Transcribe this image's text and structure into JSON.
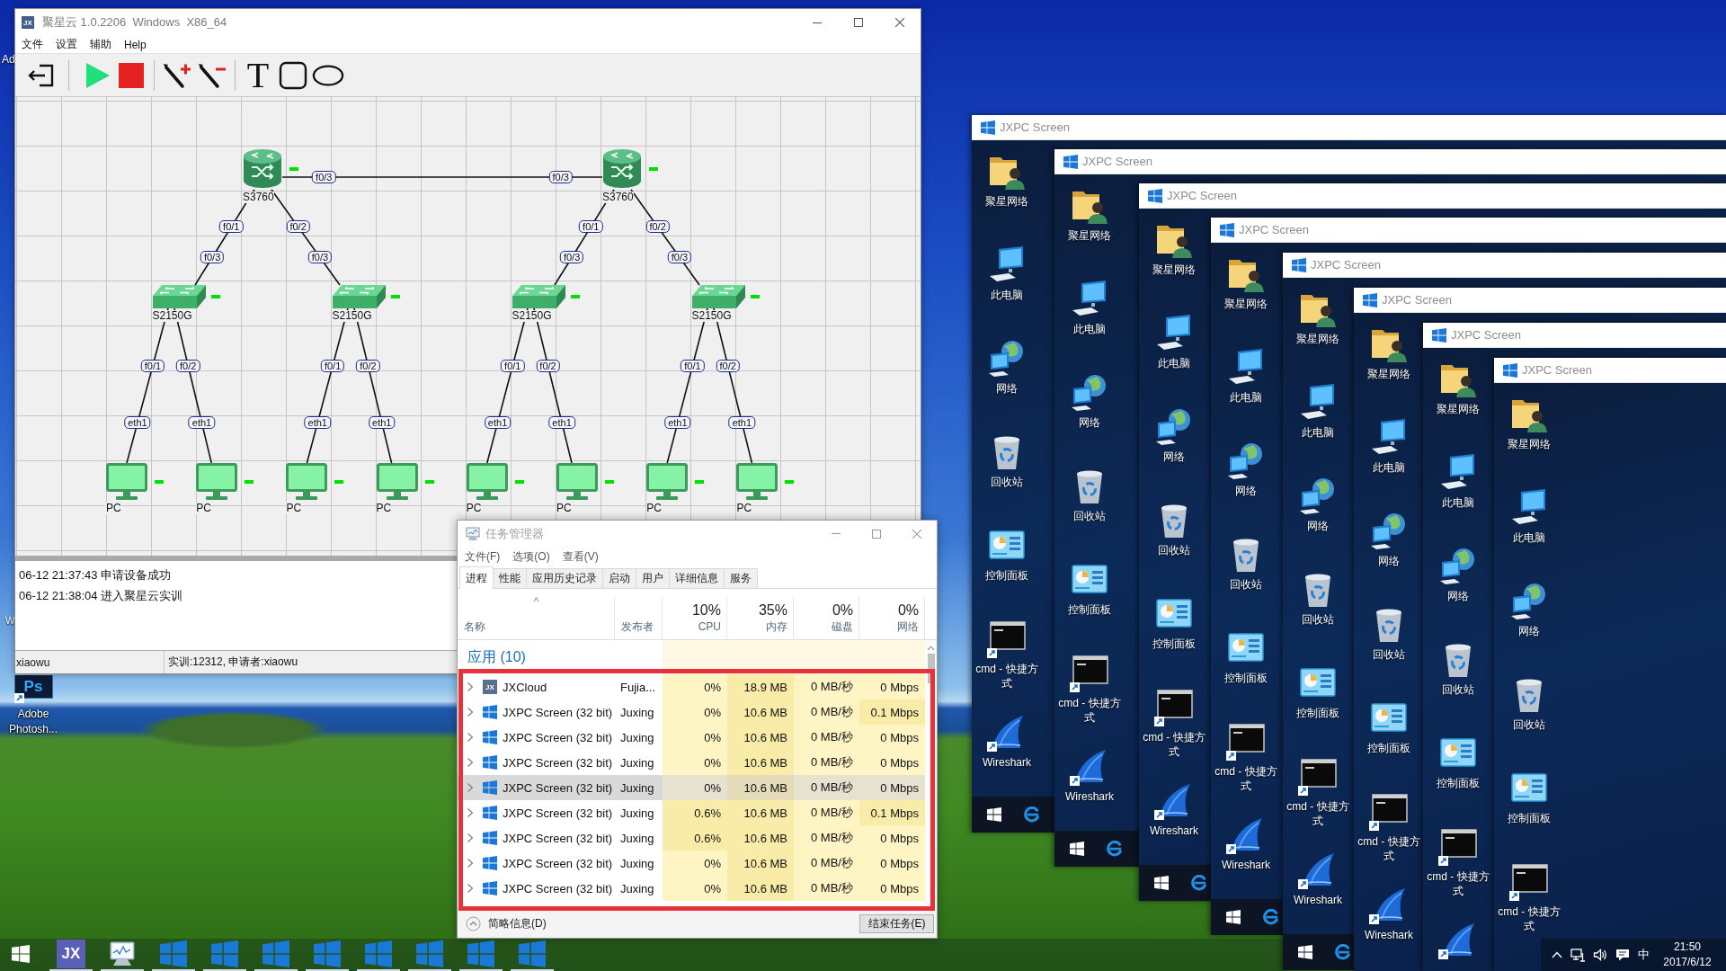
{
  "desktop": {
    "partial_icon_labels": [
      "Ad",
      "W"
    ],
    "shortcut": {
      "icon_text": "Ps",
      "label": "Adobe Photosh..."
    }
  },
  "main_window": {
    "app_icon": "JX",
    "title": "聚星云 1.0.2206  Windows  X86_64",
    "menu": [
      "文件",
      "设置",
      "辅助",
      "Help"
    ],
    "toolbar": [
      [
        {
          "kind": "exit"
        }
      ],
      [
        {
          "kind": "run"
        },
        {
          "kind": "stop"
        }
      ],
      [
        {
          "kind": "add_link"
        },
        {
          "kind": "remove_link"
        }
      ],
      [
        {
          "kind": "text",
          "glyph": "T"
        },
        {
          "kind": "rectangle"
        },
        {
          "kind": "ellipse"
        }
      ]
    ],
    "topology": {
      "core_ports": [
        "f0/3",
        "f0/3"
      ],
      "routers": [
        {
          "kind": "router",
          "label": "S3760",
          "running": true,
          "children": [
            {
              "kind": "switch",
              "label": "S2150G",
              "running": true,
              "ports": [
                "f0/1",
                "f0/3"
              ],
              "children": [
                {
                  "kind": "pc",
                  "label": "PC",
                  "running": true,
                  "ports": [
                    "f0/1",
                    "eth1"
                  ]
                },
                {
                  "kind": "pc",
                  "label": "PC",
                  "running": true,
                  "ports": [
                    "f0/2",
                    "eth1"
                  ]
                }
              ]
            },
            {
              "kind": "switch",
              "label": "S2150G",
              "running": true,
              "ports": [
                "f0/2",
                "f0/3"
              ],
              "children": [
                {
                  "kind": "pc",
                  "label": "PC",
                  "running": true,
                  "ports": [
                    "f0/1",
                    "eth1"
                  ]
                },
                {
                  "kind": "pc",
                  "label": "PC",
                  "running": true,
                  "ports": [
                    "f0/2",
                    "eth1"
                  ]
                }
              ]
            }
          ]
        },
        {
          "kind": "router",
          "label": "S3760",
          "running": true,
          "children": [
            {
              "kind": "switch",
              "label": "S2150G",
              "running": true,
              "ports": [
                "f0/1",
                "f0/3"
              ],
              "children": [
                {
                  "kind": "pc",
                  "label": "PC",
                  "running": true,
                  "ports": [
                    "f0/1",
                    "eth1"
                  ]
                },
                {
                  "kind": "pc",
                  "label": "PC",
                  "running": true,
                  "ports": [
                    "f0/2",
                    "eth1"
                  ]
                }
              ]
            },
            {
              "kind": "switch",
              "label": "S2150G",
              "running": true,
              "ports": [
                "f0/2",
                "f0/3"
              ],
              "children": [
                {
                  "kind": "pc",
                  "label": "PC",
                  "running": true,
                  "ports": [
                    "f0/1",
                    "eth1"
                  ]
                },
                {
                  "kind": "pc",
                  "label": "PC",
                  "running": true,
                  "ports": [
                    "f0/2",
                    "eth1"
                  ]
                }
              ]
            }
          ]
        }
      ]
    },
    "log": [
      "06-12 21:37:43 申请设备成功",
      "06-12 21:38:04 进入聚星云实训"
    ],
    "status_bar": [
      "xiaowu",
      "实训:12312, 申请者:xiaowu"
    ]
  },
  "task_manager": {
    "title": "任务管理器",
    "menu": [
      "文件(F)",
      "选项(O)",
      "查看(V)"
    ],
    "tabs": [
      {
        "label": "进程",
        "selected": true
      },
      {
        "label": "性能",
        "selected": false
      },
      {
        "label": "应用历史记录",
        "selected": false
      },
      {
        "label": "启动",
        "selected": false
      },
      {
        "label": "用户",
        "selected": false
      },
      {
        "label": "详细信息",
        "selected": false
      },
      {
        "label": "服务",
        "selected": false
      }
    ],
    "columns": [
      {
        "label": "名称",
        "sort_mark": "^"
      },
      {
        "label": "发布者"
      },
      {
        "usage": "10%",
        "label": "CPU"
      },
      {
        "usage": "35%",
        "label": "内存"
      },
      {
        "usage": "0%",
        "label": "磁盘"
      },
      {
        "usage": "0%",
        "label": "网络"
      }
    ],
    "group": "应用 (10)",
    "rows": [
      {
        "icon_text": "JX",
        "selected": false,
        "cells": [
          {
            "text": "JXCloud"
          },
          {
            "text": "Fujia..."
          },
          {
            "text": "0%",
            "color": "#fff4c4"
          },
          {
            "text": "18.9 MB",
            "color": "#f9eca8"
          },
          {
            "text": "0 MB/秒",
            "color": "#fff4c4"
          },
          {
            "text": "0 Mbps",
            "color": "#fff4c4"
          }
        ]
      },
      {
        "selected": false,
        "cells": [
          {
            "text": "JXPC Screen (32 bit)"
          },
          {
            "text": "Juxing"
          },
          {
            "text": "0%",
            "color": "#fff4c4"
          },
          {
            "text": "10.6 MB",
            "color": "#f9eca8"
          },
          {
            "text": "0 MB/秒",
            "color": "#fff4c4"
          },
          {
            "text": "0.1 Mbps",
            "color": "#f9eca8"
          }
        ]
      },
      {
        "selected": false,
        "cells": [
          {
            "text": "JXPC Screen (32 bit)"
          },
          {
            "text": "Juxing"
          },
          {
            "text": "0%",
            "color": "#fff4c4"
          },
          {
            "text": "10.6 MB",
            "color": "#f9eca8"
          },
          {
            "text": "0 MB/秒",
            "color": "#fff4c4"
          },
          {
            "text": "0 Mbps",
            "color": "#fff4c4"
          }
        ]
      },
      {
        "selected": false,
        "cells": [
          {
            "text": "JXPC Screen (32 bit)"
          },
          {
            "text": "Juxing"
          },
          {
            "text": "0%",
            "color": "#fff4c4"
          },
          {
            "text": "10.6 MB",
            "color": "#f9eca8"
          },
          {
            "text": "0 MB/秒",
            "color": "#fff4c4"
          },
          {
            "text": "0 Mbps",
            "color": "#fff4c4"
          }
        ]
      },
      {
        "selected": true,
        "cells": [
          {
            "text": "JXPC Screen (32 bit)"
          },
          {
            "text": "Juxing"
          },
          {
            "text": "0%",
            "color": "#e6e2cf"
          },
          {
            "text": "10.6 MB",
            "color": "#e4dcb8"
          },
          {
            "text": "0 MB/秒",
            "color": "#e6e2cf"
          },
          {
            "text": "0 Mbps",
            "color": "#e6e2cf"
          }
        ]
      },
      {
        "selected": false,
        "cells": [
          {
            "text": "JXPC Screen (32 bit)"
          },
          {
            "text": "Juxing"
          },
          {
            "text": "0.6%",
            "color": "#f9eca8"
          },
          {
            "text": "10.6 MB",
            "color": "#f9eca8"
          },
          {
            "text": "0 MB/秒",
            "color": "#fff4c4"
          },
          {
            "text": "0.1 Mbps",
            "color": "#f9eca8"
          }
        ]
      },
      {
        "selected": false,
        "cells": [
          {
            "text": "JXPC Screen (32 bit)"
          },
          {
            "text": "Juxing"
          },
          {
            "text": "0.6%",
            "color": "#f9eca8"
          },
          {
            "text": "10.6 MB",
            "color": "#f9eca8"
          },
          {
            "text": "0 MB/秒",
            "color": "#fff4c4"
          },
          {
            "text": "0 Mbps",
            "color": "#fff4c4"
          }
        ]
      },
      {
        "selected": false,
        "cells": [
          {
            "text": "JXPC Screen (32 bit)"
          },
          {
            "text": "Juxing"
          },
          {
            "text": "0%",
            "color": "#fff4c4"
          },
          {
            "text": "10.6 MB",
            "color": "#f9eca8"
          },
          {
            "text": "0 MB/秒",
            "color": "#fff4c4"
          },
          {
            "text": "0 Mbps",
            "color": "#fff4c4"
          }
        ]
      },
      {
        "selected": false,
        "cells": [
          {
            "text": "JXPC Screen (32 bit)"
          },
          {
            "text": "Juxing"
          },
          {
            "text": "0%",
            "color": "#fff4c4"
          },
          {
            "text": "10.6 MB",
            "color": "#f9eca8"
          },
          {
            "text": "0 MB/秒",
            "color": "#fff4c4"
          },
          {
            "text": "0 Mbps",
            "color": "#fff4c4"
          }
        ]
      }
    ],
    "details_toggle": "简略信息(D)",
    "end_task": "结束任务(E)"
  },
  "remote_windows": [
    {
      "title": "JXPC Screen",
      "icons": [
        {
          "kind": "folder_user",
          "label": "聚星网络"
        },
        {
          "kind": "computer",
          "label": "此电脑"
        },
        {
          "kind": "network",
          "label": "网络"
        },
        {
          "kind": "recycle_bin",
          "label": "回收站"
        },
        {
          "kind": "control_panel",
          "label": "控制面板"
        },
        {
          "kind": "cmd",
          "label": "cmd - 快捷方式"
        },
        {
          "kind": "wireshark",
          "label": "Wireshark"
        }
      ]
    },
    {
      "title": "JXPC Screen",
      "icons": [
        {
          "kind": "folder_user",
          "label": "聚星网络"
        },
        {
          "kind": "computer",
          "label": "此电脑"
        },
        {
          "kind": "network",
          "label": "网络"
        },
        {
          "kind": "recycle_bin",
          "label": "回收站"
        },
        {
          "kind": "control_panel",
          "label": "控制面板"
        },
        {
          "kind": "cmd",
          "label": "cmd - 快捷方式"
        },
        {
          "kind": "wireshark",
          "label": "Wireshark"
        }
      ]
    },
    {
      "title": "JXPC Screen",
      "icons": [
        {
          "kind": "folder_user",
          "label": "聚星网络"
        },
        {
          "kind": "computer",
          "label": "此电脑"
        },
        {
          "kind": "network",
          "label": "网络"
        },
        {
          "kind": "recycle_bin",
          "label": "回收站"
        },
        {
          "kind": "control_panel",
          "label": "控制面板"
        },
        {
          "kind": "cmd",
          "label": "cmd - 快捷方式"
        },
        {
          "kind": "wireshark",
          "label": "Wireshark"
        }
      ]
    },
    {
      "title": "JXPC Screen",
      "icons": [
        {
          "kind": "folder_user",
          "label": "聚星网络"
        },
        {
          "kind": "computer",
          "label": "此电脑"
        },
        {
          "kind": "network",
          "label": "网络"
        },
        {
          "kind": "recycle_bin",
          "label": "回收站"
        },
        {
          "kind": "control_panel",
          "label": "控制面板"
        },
        {
          "kind": "cmd",
          "label": "cmd - 快捷方式"
        },
        {
          "kind": "wireshark",
          "label": "Wireshark"
        }
      ]
    },
    {
      "title": "JXPC Screen",
      "icons": [
        {
          "kind": "folder_user",
          "label": "聚星网络"
        },
        {
          "kind": "computer",
          "label": "此电脑"
        },
        {
          "kind": "network",
          "label": "网络"
        },
        {
          "kind": "recycle_bin",
          "label": "回收站"
        },
        {
          "kind": "control_panel",
          "label": "控制面板"
        },
        {
          "kind": "cmd",
          "label": "cmd - 快捷方式"
        },
        {
          "kind": "wireshark",
          "label": "Wireshark"
        }
      ]
    },
    {
      "title": "JXPC Screen",
      "icons": [
        {
          "kind": "folder_user",
          "label": "聚星网络"
        },
        {
          "kind": "computer",
          "label": "此电脑"
        },
        {
          "kind": "network",
          "label": "网络"
        },
        {
          "kind": "recycle_bin",
          "label": "回收站"
        },
        {
          "kind": "control_panel",
          "label": "控制面板"
        },
        {
          "kind": "cmd",
          "label": "cmd - 快捷方式"
        },
        {
          "kind": "wireshark",
          "label": "Wireshark"
        }
      ]
    },
    {
      "title": "JXPC Screen",
      "icons": [
        {
          "kind": "folder_user",
          "label": "聚星网络"
        },
        {
          "kind": "computer",
          "label": "此电脑"
        },
        {
          "kind": "network",
          "label": "网络"
        },
        {
          "kind": "recycle_bin",
          "label": "回收站"
        },
        {
          "kind": "control_panel",
          "label": "控制面板"
        },
        {
          "kind": "cmd",
          "label": "cmd - 快捷方式"
        },
        {
          "kind": "wireshark"
        }
      ]
    },
    {
      "title": "JXPC Screen",
      "icons": [
        {
          "kind": "folder_user",
          "label": "聚星网络"
        },
        {
          "kind": "computer",
          "label": "此电脑"
        },
        {
          "kind": "network",
          "label": "网络"
        },
        {
          "kind": "recycle_bin",
          "label": "回收站"
        },
        {
          "kind": "control_panel",
          "label": "控制面板"
        },
        {
          "kind": "cmd",
          "label": "cmd - 快捷方式"
        }
      ]
    }
  ],
  "taskbar": {
    "items": [
      {
        "kind": "start",
        "running": false
      },
      {
        "kind": "app",
        "icon_text": "JX",
        "running": true
      },
      {
        "kind": "monitor",
        "running": true
      },
      {
        "kind": "windows",
        "running": true
      },
      {
        "kind": "windows",
        "running": true
      },
      {
        "kind": "windows",
        "running": true
      },
      {
        "kind": "windows",
        "running": true
      },
      {
        "kind": "windows",
        "running": true
      },
      {
        "kind": "windows",
        "running": true
      },
      {
        "kind": "windows",
        "running": true
      },
      {
        "kind": "windows",
        "running": true
      }
    ],
    "tray": {
      "ime": "中",
      "time": "21:50",
      "date": "2017/6/12"
    }
  }
}
